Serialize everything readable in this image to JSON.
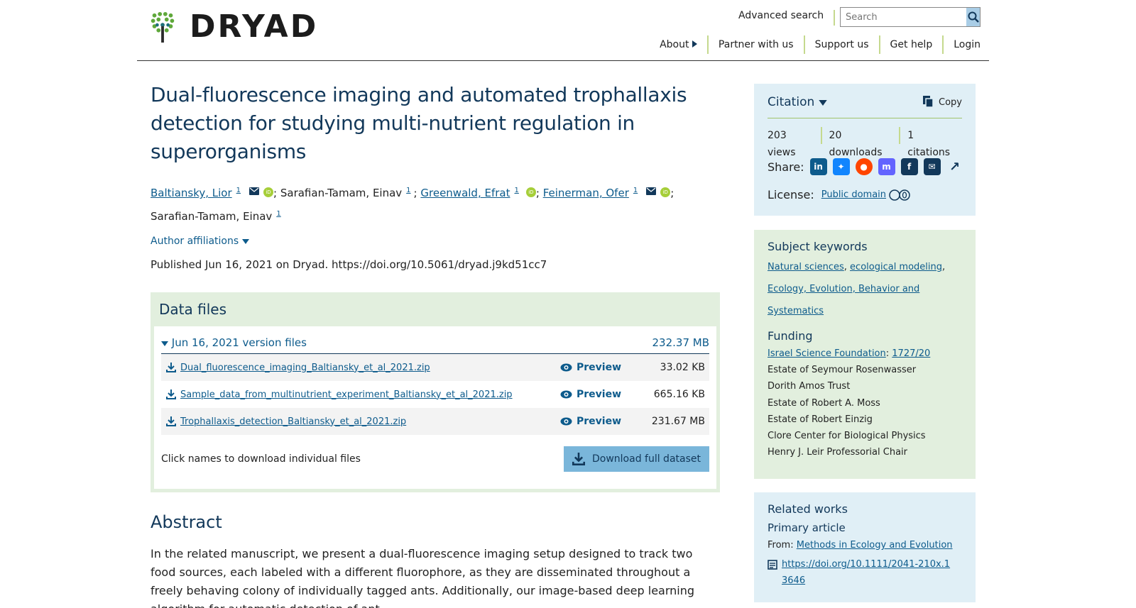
{
  "header": {
    "logo_text": "DRYAD",
    "advanced_search": "Advanced search",
    "search_placeholder": "Search",
    "nav": [
      "About",
      "Partner with us",
      "Support us",
      "Get help",
      "Login"
    ]
  },
  "dataset": {
    "title": "Dual-fluorescence imaging and automated trophallaxis detection for studying multi-nutrient regulation in superorganisms",
    "authors": [
      {
        "name": "Baltiansky, Lior",
        "sup": "1",
        "link": true,
        "email": true,
        "orcid": true
      },
      {
        "name": "Sarafian-Tamam, Einav",
        "sup": "1",
        "link": false,
        "email": false,
        "orcid": false
      },
      {
        "name": "Greenwald, Efrat",
        "sup": "1",
        "link": true,
        "email": false,
        "orcid": true
      },
      {
        "name": "Feinerman, Ofer",
        "sup": "1",
        "link": true,
        "email": true,
        "orcid": true
      },
      {
        "name": "Sarafian-Tamam, Einav",
        "sup": "1",
        "link": false,
        "email": false,
        "orcid": false
      }
    ],
    "affiliations_label": "Author affiliations",
    "published": "Published Jun 16, 2021 on Dryad. https://doi.org/10.5061/dryad.j9kd51cc7"
  },
  "data_files": {
    "heading": "Data files",
    "version_label": "Jun 16, 2021 version files",
    "version_size": "232.37 MB",
    "preview_label": "Preview",
    "files": [
      {
        "name": "Dual_fluorescence_imaging_Baltiansky_et_al_2021.zip",
        "size": "33.02 KB"
      },
      {
        "name": "Sample_data_from_multinutrient_experiment_Baltiansky_et_al_2021.zip",
        "size": "665.16 KB"
      },
      {
        "name": "Trophallaxis_detection_Baltiansky_et_al_2021.zip",
        "size": "231.67 MB"
      }
    ],
    "hint": "Click names to download individual files",
    "download_label": "Download full dataset"
  },
  "abstract": {
    "heading": "Abstract",
    "text": "In the related manuscript, we present a dual-fluorescence imaging setup designed to track two food sources, each labeled with a different fluorophore, as they are disseminated throughout a freely behaving colony of individually tagged ants. Additionally, our image-based deep learning algorithm for automatic detection of ant"
  },
  "sidebar": {
    "citation_label": "Citation",
    "copy_label": "Copy",
    "views": "203 views",
    "downloads": "20 downloads",
    "citations": "1 citations",
    "share_label": "Share:",
    "license_label": "License:",
    "license_value": "Public domain",
    "keywords_heading": "Subject keywords",
    "keywords": [
      "Natural sciences",
      "ecological modeling",
      "Ecology, Evolution, Behavior and Systematics"
    ],
    "funding_heading": "Funding",
    "funding_first": {
      "name": "Israel Science Foundation",
      "grant": "1727/20"
    },
    "funding_others": [
      "Estate of Seymour Rosenwasser",
      "Dorith Amos Trust",
      "Estate of Robert A. Moss",
      "Estate of Robert Einzig",
      "Clore Center for Biological Physics",
      "Henry J. Leir Professorial Chair"
    ],
    "related_heading": "Related works",
    "related_sub": "Primary article",
    "related_from_label": "From:",
    "related_from": "Methods in Ecology and Evolution",
    "related_doi": "https://doi.org/10.1111/2041-210x.13646"
  },
  "colors": {
    "title": "#12385a",
    "link": "#0d5b8c",
    "green_panel": "#e2efde",
    "blue_panel": "#e0eff6",
    "button": "#7ab6da"
  }
}
